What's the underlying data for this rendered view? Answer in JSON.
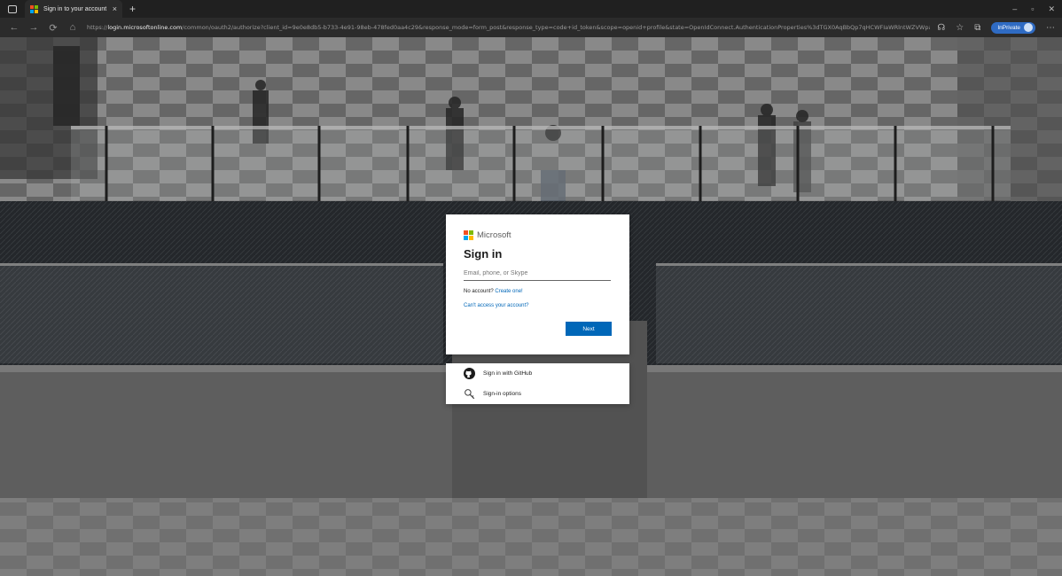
{
  "browser": {
    "tab_title": "Sign in to your account",
    "new_tab": "+",
    "tab_close": "×",
    "url_prefix": "https://",
    "url_host": "login.microsoftonline.com",
    "url_path": "/common/oauth2/authorize?client_id=9e0e8db5-b733-4e91-98eb-478fed0aa4c29&response_mode=form_post&response_type=code+id_token&scope=openid+profile&state=OpenIdConnect.AuthenticationProperties%3dTGX0AqBbQp7qHCWFIaWRlntWZVWpaFIqrPPeNnW-A9Bq8vcYRXICBhAvsh9ID...",
    "inprivate_label": "InPrivate",
    "window_min": "–",
    "window_max": "▫",
    "window_close": "✕"
  },
  "colors": {
    "ms_red": "#f25022",
    "ms_green": "#7fba00",
    "ms_blue": "#00a4ef",
    "ms_yellow": "#ffb900",
    "accent": "#0067b8"
  },
  "signin": {
    "brand": "Microsoft",
    "title": "Sign in",
    "email_placeholder": "Email, phone, or Skype",
    "email_value": "",
    "no_account_text": "No account?",
    "create_link": "Create one!",
    "cant_access_link": "Can't access your account?",
    "next_button": "Next"
  },
  "options": {
    "github_label": "Sign in with GitHub",
    "github_icon": "github-icon",
    "signin_options_label": "Sign-in options",
    "key_icon": "key-search-icon"
  }
}
